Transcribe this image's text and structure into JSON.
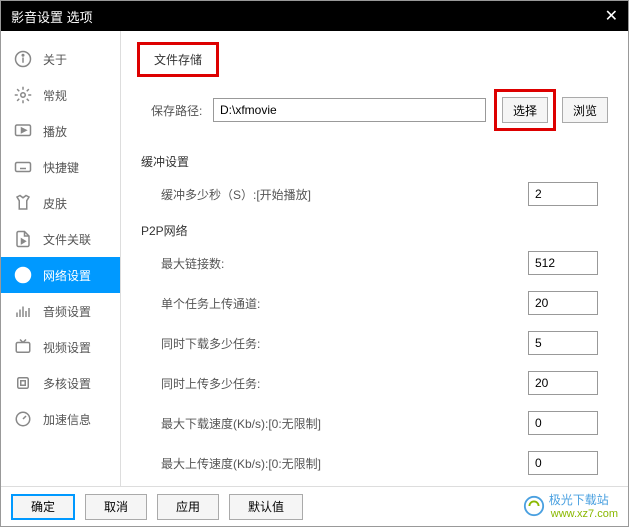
{
  "title": "影音设置 选项",
  "sidebar": {
    "items": [
      {
        "label": "关于"
      },
      {
        "label": "常规"
      },
      {
        "label": "播放"
      },
      {
        "label": "快捷键"
      },
      {
        "label": "皮肤"
      },
      {
        "label": "文件关联"
      },
      {
        "label": "网络设置"
      },
      {
        "label": "音频设置"
      },
      {
        "label": "视频设置"
      },
      {
        "label": "多核设置"
      },
      {
        "label": "加速信息"
      }
    ]
  },
  "main": {
    "fileStorage": {
      "title": "文件存储",
      "pathLabel": "保存路径:",
      "pathValue": "D:\\xfmovie",
      "selectBtn": "选择",
      "browseBtn": "浏览"
    },
    "buffer": {
      "title": "缓冲设置",
      "label": "缓冲多少秒（S）:[开始播放]",
      "value": "2"
    },
    "p2p": {
      "title": "P2P网络",
      "maxConn": {
        "label": "最大链接数:",
        "value": "512"
      },
      "uploadChan": {
        "label": "单个任务上传通道:",
        "value": "20"
      },
      "downTasks": {
        "label": "同时下载多少任务:",
        "value": "5"
      },
      "upTasks": {
        "label": "同时上传多少任务:",
        "value": "20"
      },
      "maxDown": {
        "label": "最大下载速度(Kb/s):[0:无限制]",
        "value": "0"
      },
      "maxUp": {
        "label": "最大上传速度(Kb/s):[0:无限制]",
        "value": "0"
      }
    }
  },
  "footer": {
    "ok": "确定",
    "cancel": "取消",
    "apply": "应用",
    "default": "默认值"
  },
  "watermark": {
    "name": "极光下载站",
    "url": "www.xz7.com"
  }
}
